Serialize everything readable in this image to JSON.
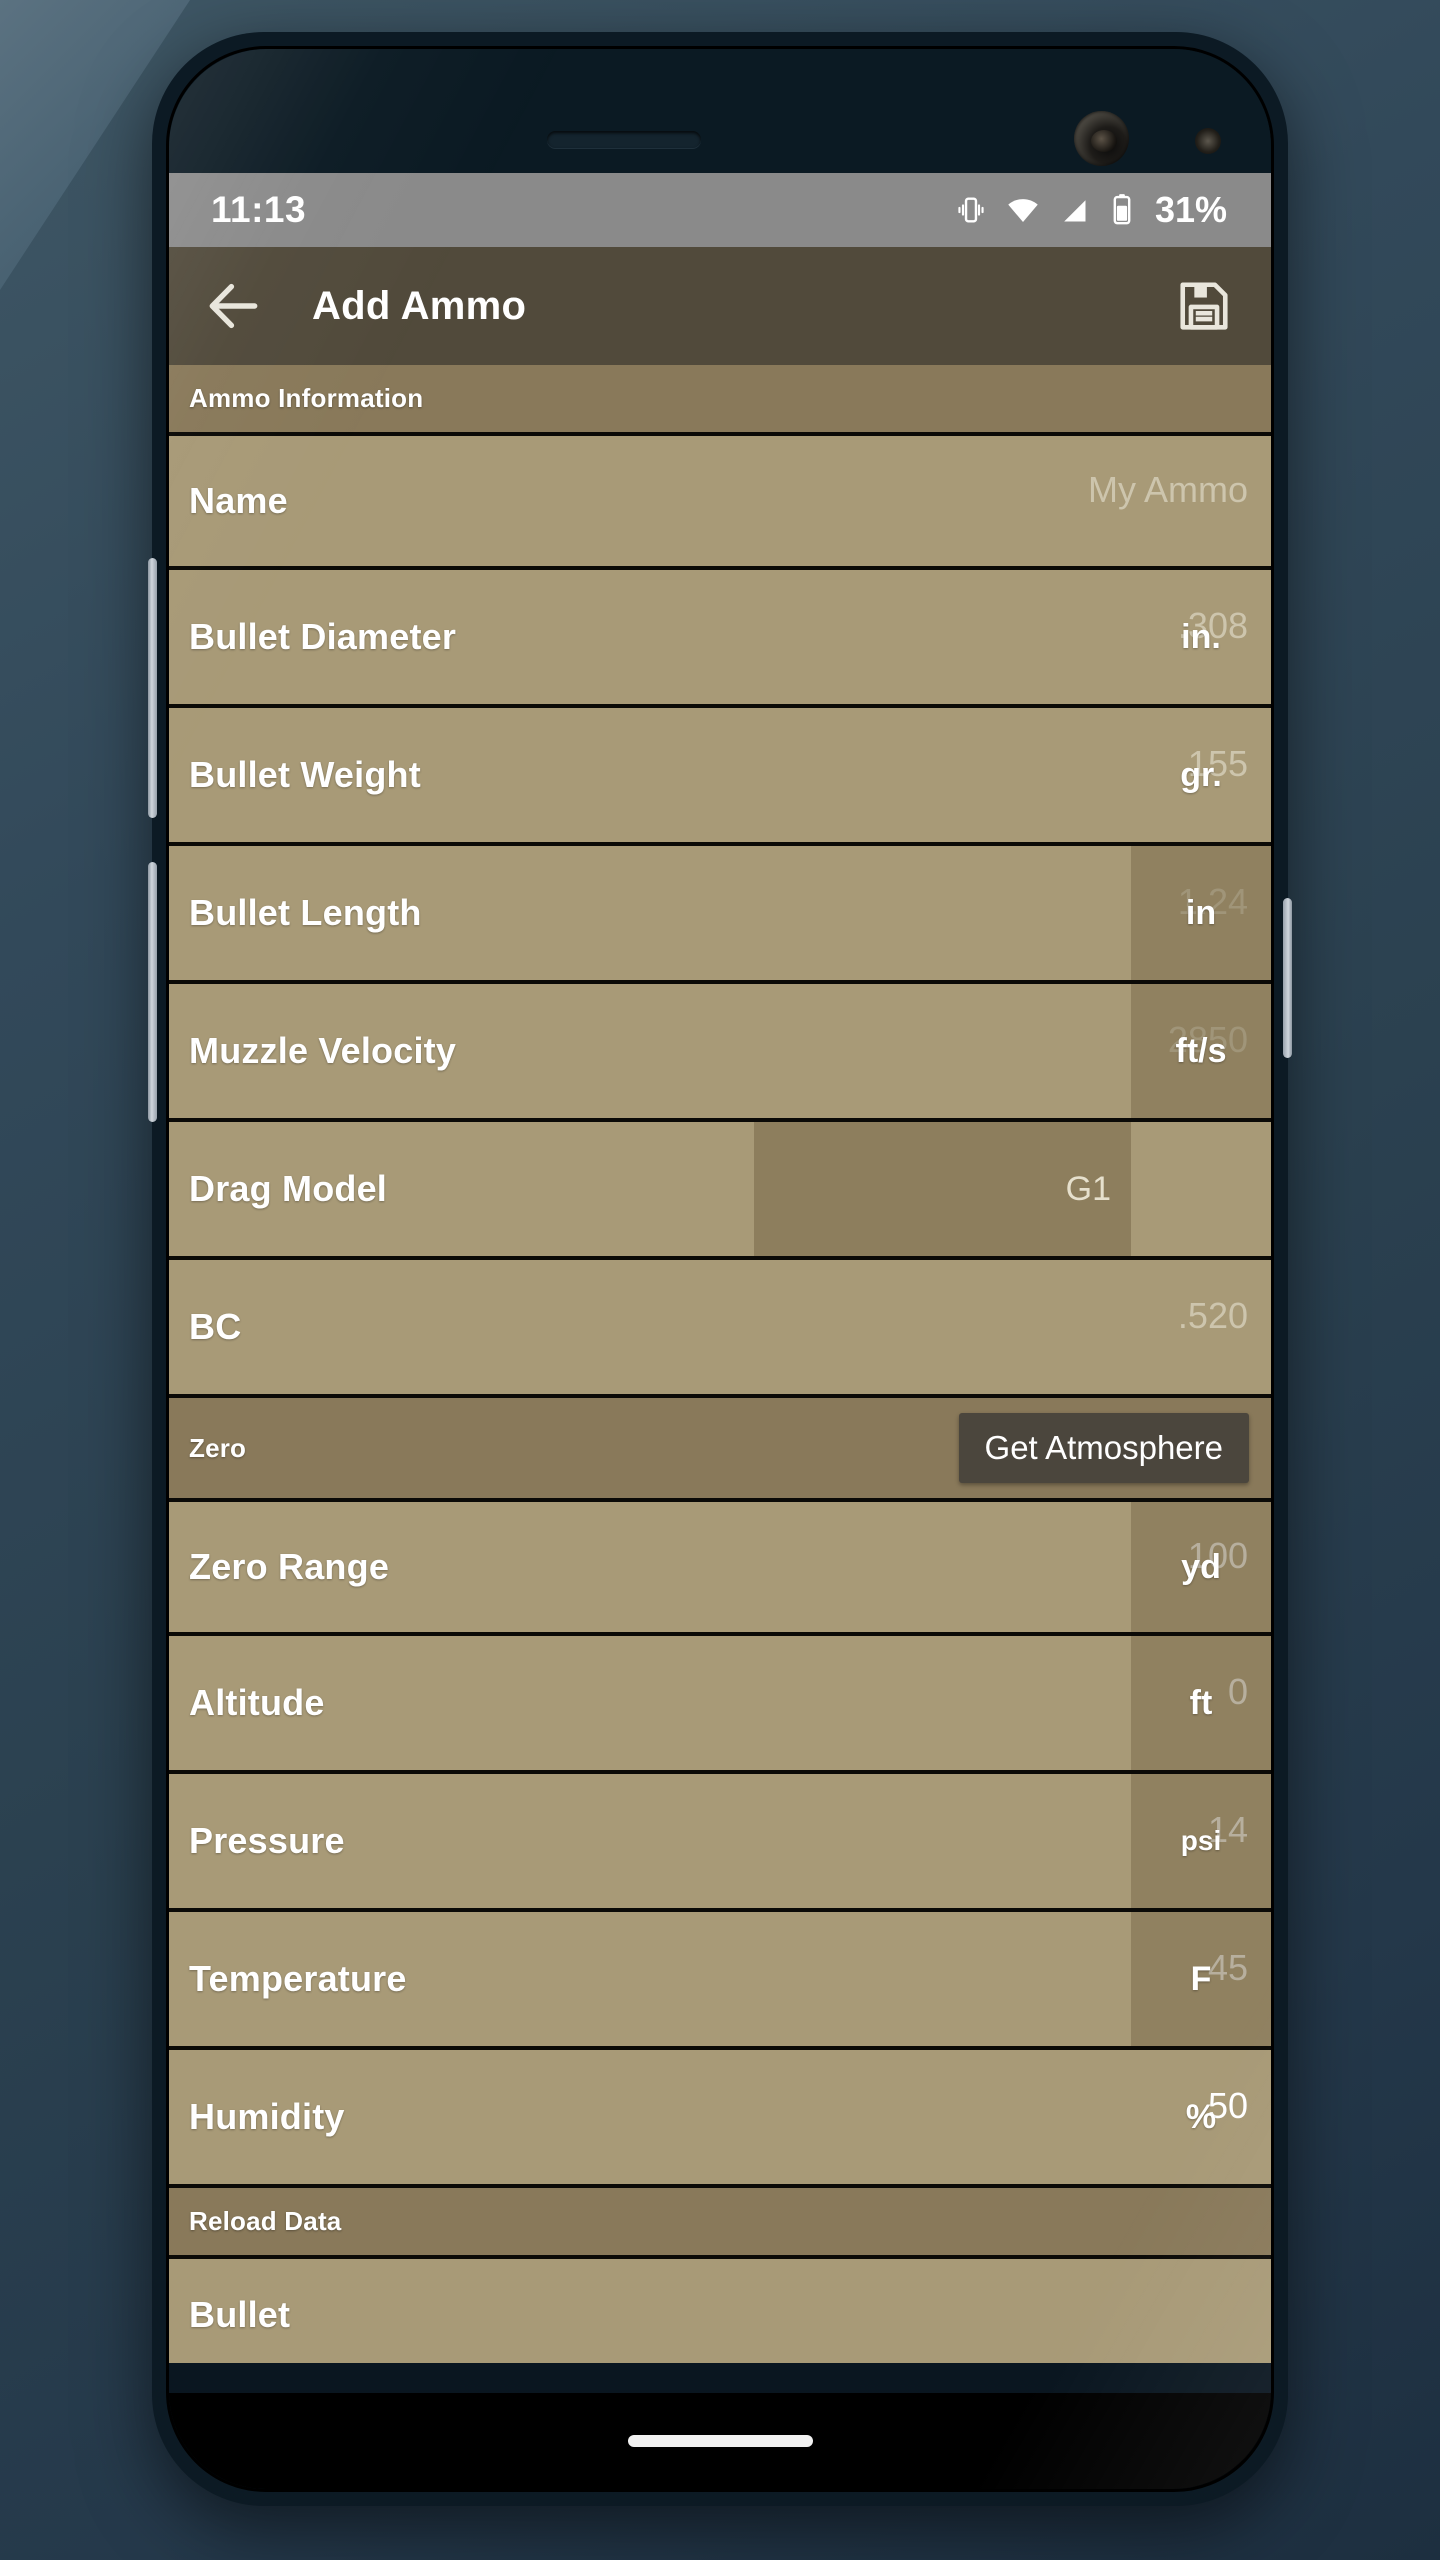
{
  "statusbar": {
    "clock": "11:13",
    "battery_percent": "31%",
    "icons": [
      "vibrate-icon",
      "wifi-icon",
      "signal-icon",
      "battery-icon"
    ]
  },
  "appbar": {
    "back_icon": "arrow-left-icon",
    "title": "Add Ammo",
    "save_icon": "save-floppy-icon"
  },
  "colors": {
    "appbar_bg": "#514a3b",
    "section_bg": "#89795a",
    "row_bg": "#a89a77",
    "unit_box_bg": "#7c6e4e",
    "button_bg": "#4b463d",
    "statusbar_bg": "#8a8a8a",
    "divider": "#0b0a07",
    "text_primary": "#ffffff",
    "text_placeholder": "#cdc5ad"
  },
  "sections": [
    {
      "id": "ammo-information",
      "title": "Ammo Information",
      "fields": [
        {
          "label": "Name",
          "value": "My Ammo",
          "filled": false,
          "unit": "",
          "type": "text"
        },
        {
          "label": "Bullet Diameter",
          "value": ".308",
          "filled": false,
          "unit": "in.",
          "type": "number"
        },
        {
          "label": "Bullet Weight",
          "value": "155",
          "filled": false,
          "unit": "gr.",
          "type": "number"
        },
        {
          "label": "Bullet Length",
          "value": "1.24",
          "filled": false,
          "unit": "in",
          "type": "number",
          "unit_boxed": true
        },
        {
          "label": "Muzzle Velocity",
          "value": "2850",
          "filled": false,
          "unit": "ft/s",
          "type": "number",
          "unit_boxed": true
        },
        {
          "label": "Drag Model",
          "value": "G1",
          "filled": false,
          "unit": "",
          "type": "select"
        },
        {
          "label": "BC",
          "value": ".520",
          "filled": false,
          "unit": "",
          "type": "number"
        }
      ]
    },
    {
      "id": "zero",
      "title": "Zero",
      "action_label": "Get Atmosphere",
      "fields": [
        {
          "label": "Zero Range",
          "value": "100",
          "filled": true,
          "unit": "yd",
          "type": "number",
          "unit_boxed": true
        },
        {
          "label": "Altitude",
          "value": "0",
          "filled": true,
          "unit": "ft",
          "type": "number",
          "unit_boxed": true
        },
        {
          "label": "Pressure",
          "value": "14",
          "filled": true,
          "unit": "psi",
          "type": "number",
          "unit_boxed": true,
          "unit_small": true
        },
        {
          "label": "Temperature",
          "value": "45",
          "filled": true,
          "unit": "F",
          "type": "number",
          "unit_boxed": true
        },
        {
          "label": "Humidity",
          "value": "50",
          "filled": true,
          "unit": "%",
          "type": "number"
        }
      ]
    },
    {
      "id": "reload-data",
      "title": "Reload Data",
      "fields": [
        {
          "label": "Bullet",
          "value": "",
          "filled": false,
          "unit": "",
          "type": "text",
          "partial": true
        }
      ]
    }
  ],
  "navbar": {
    "gesture_pill": "home-gesture-pill"
  }
}
